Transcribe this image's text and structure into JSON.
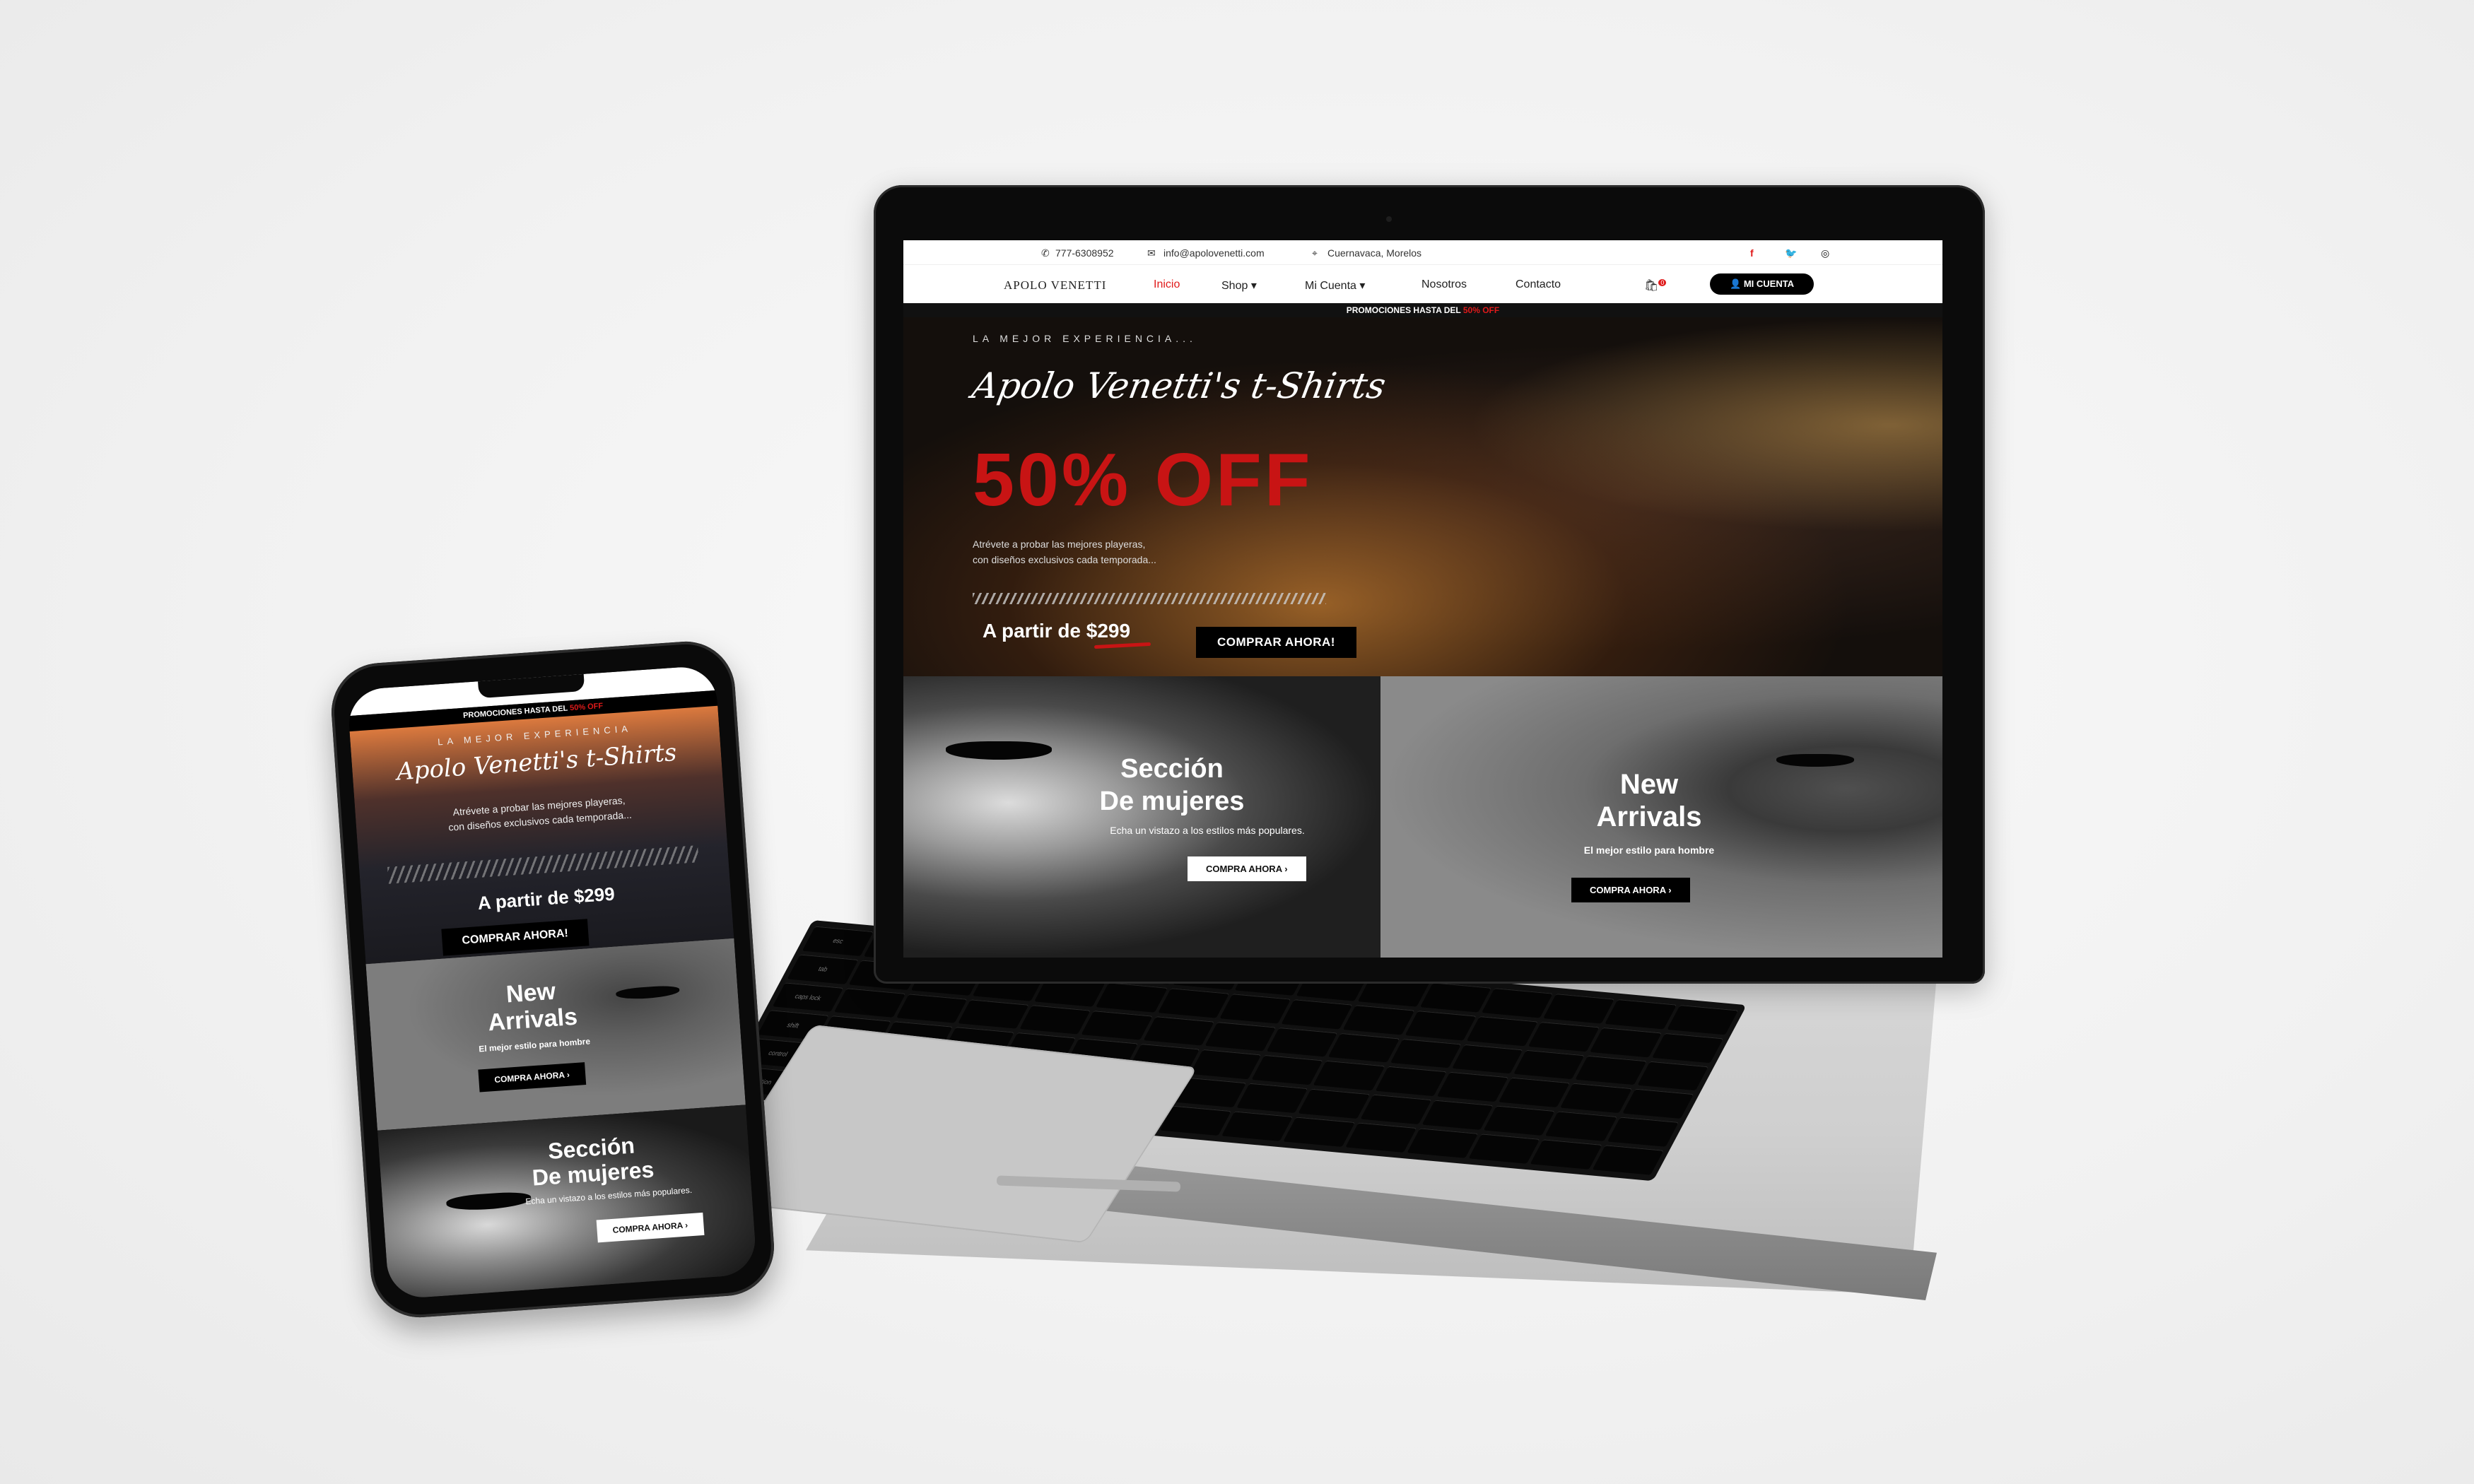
{
  "desktop": {
    "topbar": {
      "phone": "777-6308952",
      "email": "info@apolovenetti.com",
      "location": "Cuernavaca, Morelos"
    },
    "nav": {
      "logo": "APOLO VENETTI",
      "items": [
        "Inicio",
        "Shop",
        "Mi Cuenta",
        "Nosotros",
        "Contacto"
      ],
      "cart_count": "0",
      "account_button": "MI CUENTA"
    },
    "promo": {
      "prefix": "PROMOCIONES HASTA DEL ",
      "highlight": "50% OFF"
    },
    "hero": {
      "kicker": "LA MEJOR EXPERIENCIA...",
      "script_title": "Apolo Venetti's t-Shirts",
      "headline": "50% OFF",
      "description_line1": "Atrévete a probar las mejores playeras,",
      "description_line2": "con diseños exclusivos cada temporada...",
      "price_prefix": "A partir de ",
      "price": "$299",
      "cta": "COMPRAR AHORA!"
    },
    "women": {
      "title_line1": "Sección",
      "title_line2": "De mujeres",
      "subtitle": "Echa un vistazo a los estilos más populares.",
      "button": "COMPRA AHORA  ›"
    },
    "men": {
      "title_line1": "New",
      "title_line2": "Arrivals",
      "subtitle": "El mejor estilo para hombre",
      "button": "COMPRA AHORA  ›"
    }
  },
  "mobile": {
    "promo": {
      "prefix": "PROMOCIONES HASTA DEL ",
      "highlight": "50% OFF"
    },
    "hero": {
      "kicker": "LA MEJOR EXPERIENCIA",
      "script_title": "Apolo Venetti's t-Shirts",
      "description_line1": "Atrévete a probar las mejores playeras,",
      "description_line2": "con diseños exclusivos cada temporada...",
      "price_prefix": "A partir de ",
      "price": "$299",
      "cta": "COMPRAR AHORA!"
    },
    "men": {
      "title_line1": "New",
      "title_line2": "Arrivals",
      "subtitle": "El mejor estilo para hombre",
      "button": "COMPRA AHORA  ›"
    },
    "women": {
      "title_line1": "Sección",
      "title_line2": "De mujeres",
      "subtitle": "Echa un vistazo a los estilos más populares.",
      "button": "COMPRA AHORA  ›"
    }
  },
  "keyboard_labels": [
    "esc",
    "tab",
    "caps lock",
    "shift",
    "control",
    "option",
    "command",
    "delete",
    "return",
    "shift",
    "option"
  ],
  "colors": {
    "accent": "#e01a1a",
    "dark": "#000000",
    "light": "#ffffff"
  },
  "icons": [
    "phone-icon",
    "mail-icon",
    "location-pin-icon",
    "facebook-icon",
    "twitter-icon",
    "instagram-icon",
    "cart-icon",
    "user-icon",
    "chevron-down-icon",
    "chevron-right-icon"
  ]
}
